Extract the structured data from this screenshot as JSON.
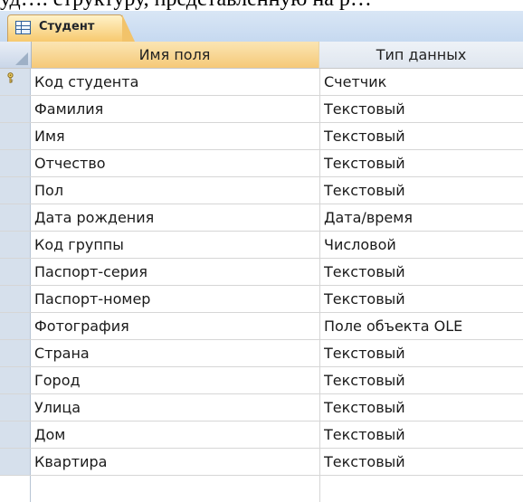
{
  "document": {
    "text_line": "уд…. структуру, представленную на р…"
  },
  "tab": {
    "label": "Студент"
  },
  "grid": {
    "headers": {
      "field_name": "Имя поля",
      "data_type": "Тип данных"
    },
    "rows": [
      {
        "name": "Код студента",
        "type": "Счетчик",
        "primary_key": true
      },
      {
        "name": "Фамилия",
        "type": "Текстовый"
      },
      {
        "name": "Имя",
        "type": "Текстовый"
      },
      {
        "name": "Отчество",
        "type": "Текстовый"
      },
      {
        "name": "Пол",
        "type": "Текстовый"
      },
      {
        "name": "Дата рождения",
        "type": "Дата/время"
      },
      {
        "name": "Код группы",
        "type": "Числовой"
      },
      {
        "name": "Паспорт-серия",
        "type": "Текстовый"
      },
      {
        "name": "Паспорт-номер",
        "type": "Текстовый"
      },
      {
        "name": "Фотография",
        "type": "Поле объекта OLE"
      },
      {
        "name": "Страна",
        "type": "Текстовый"
      },
      {
        "name": "Город",
        "type": "Текстовый"
      },
      {
        "name": "Улица",
        "type": "Текстовый"
      },
      {
        "name": "Дом",
        "type": "Текстовый"
      },
      {
        "name": "Квартира",
        "type": "Текстовый"
      },
      {
        "name": "",
        "type": ""
      }
    ]
  },
  "colors": {
    "tab_active": "#f7c96e",
    "header_bg": "#f5c978",
    "row_selector": "#d6e0ec"
  }
}
